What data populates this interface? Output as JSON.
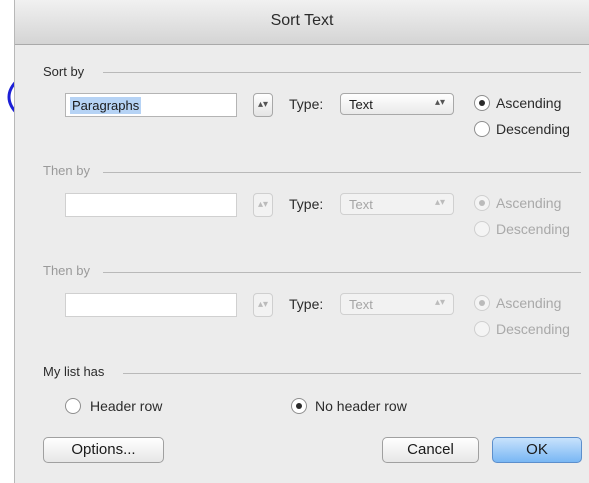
{
  "window": {
    "title": "Sort Text"
  },
  "sort_by": {
    "label": "Sort by",
    "field_value": "Paragraphs",
    "stepper_glyph": "▴▾",
    "type_label": "Type:",
    "type_value": "Text",
    "popup_glyph": "▴▾",
    "ascending": "Ascending",
    "descending": "Descending",
    "selected": "ascending"
  },
  "then_by_1": {
    "label": "Then by",
    "field_value": "",
    "type_label": "Type:",
    "type_value": "Text",
    "ascending": "Ascending",
    "descending": "Descending"
  },
  "then_by_2": {
    "label": "Then by",
    "field_value": "",
    "type_label": "Type:",
    "type_value": "Text",
    "ascending": "Ascending",
    "descending": "Descending"
  },
  "my_list_has": {
    "label": "My list has",
    "header_row": "Header row",
    "no_header_row": "No header row",
    "selected": "no_header_row"
  },
  "buttons": {
    "options": "Options...",
    "cancel": "Cancel",
    "ok": "OK"
  },
  "annotation": {
    "color": "#1c1fd6"
  },
  "colors": {
    "selection": "#b6d3f5",
    "default_button": "#79b7f4"
  }
}
